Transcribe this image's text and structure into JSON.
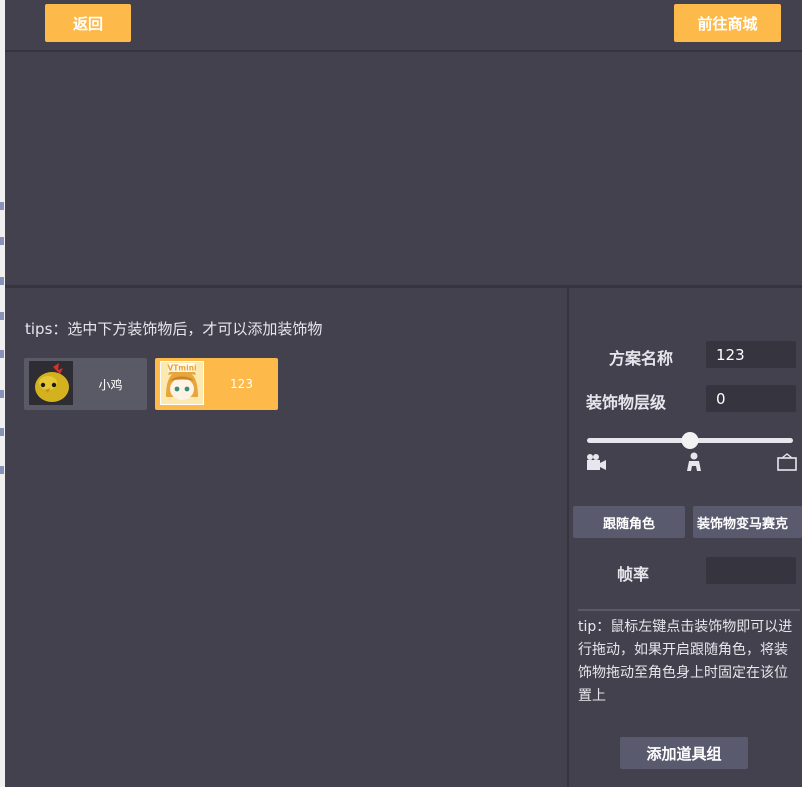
{
  "topbar": {
    "back_label": "返回",
    "shop_label": "前往商城"
  },
  "left": {
    "tips": "tips：选中下方装饰物后，才可以添加装饰物",
    "items": [
      {
        "label": "小鸡",
        "icon": "chick-icon",
        "selected": false
      },
      {
        "label": "123",
        "icon": "vtmini-avatar-icon",
        "selected": true
      }
    ]
  },
  "right": {
    "scheme_name_label": "方案名称",
    "scheme_name_value": "123",
    "layer_label": "装饰物层级",
    "layer_value": "0",
    "slider": {
      "value": 0.5,
      "left_icon": "camera-icon",
      "middle_icon": "person-icon",
      "right_icon": "background-icon"
    },
    "follow_button": "跟随角色",
    "mosaic_button": "装饰物变马赛克",
    "fps_label": "帧率",
    "fps_value": "",
    "tip": "tip：鼠标左键点击装饰物即可以进行拖动，如果开启跟随角色，将装饰物拖动至角色身上时固定在该位置上",
    "add_group_button": "添加道具组"
  },
  "colors": {
    "background": "#42414d",
    "accent": "#fdb94a",
    "input_bg": "#35343f",
    "button_dark": "#5a5a6e"
  }
}
